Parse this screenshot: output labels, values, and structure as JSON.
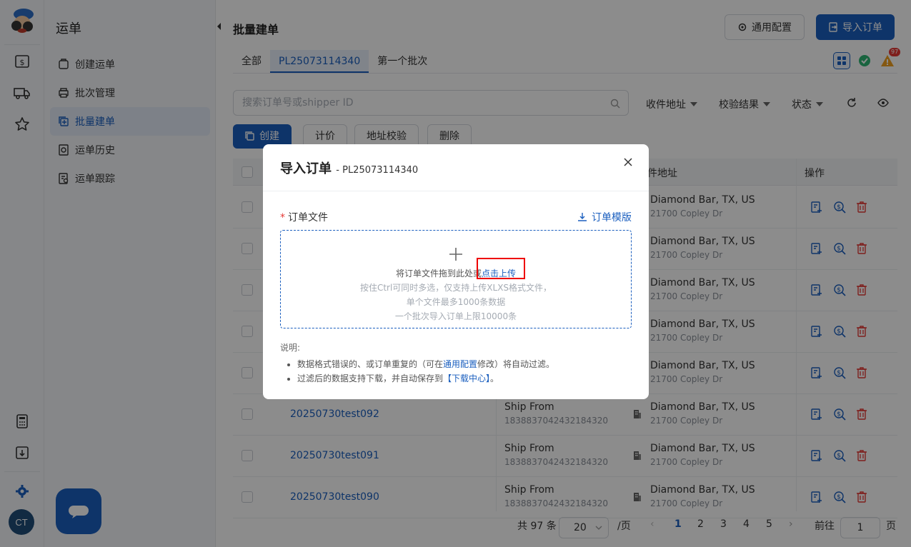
{
  "app": {
    "module_title": "运单",
    "avatar": "CT"
  },
  "sidebar": {
    "items": [
      {
        "label": "创建运单"
      },
      {
        "label": "批次管理"
      },
      {
        "label": "批量建单"
      },
      {
        "label": "运单历史"
      },
      {
        "label": "运单跟踪"
      }
    ]
  },
  "header": {
    "title": "批量建单",
    "config_label": "通用配置",
    "import_label": "导入订单"
  },
  "tabs": [
    {
      "label": "全部"
    },
    {
      "label": "PL25073114340"
    },
    {
      "label": "第一个批次"
    }
  ],
  "status": {
    "warning_count": "97"
  },
  "search": {
    "placeholder": "搜索订单号或shipper ID"
  },
  "filters": {
    "address": "收件地址",
    "validation": "校验结果",
    "status": "状态"
  },
  "toolbar": {
    "create": "创建",
    "price": "计价",
    "verify": "地址校验",
    "delete": "删除"
  },
  "table": {
    "headers": {
      "address": "件地址",
      "actions": "操作"
    },
    "rows": [
      {
        "order_id": "",
        "ship_from": "",
        "ship_from_id": "",
        "address": "Diamond Bar, TX, US",
        "street": "21700 Copley Dr"
      },
      {
        "order_id": "",
        "ship_from": "",
        "ship_from_id": "",
        "address": "Diamond Bar, TX, US",
        "street": "21700 Copley Dr"
      },
      {
        "order_id": "",
        "ship_from": "",
        "ship_from_id": "",
        "address": "Diamond Bar, TX, US",
        "street": "21700 Copley Dr"
      },
      {
        "order_id": "",
        "ship_from": "",
        "ship_from_id": "",
        "address": "Diamond Bar, TX, US",
        "street": "21700 Copley Dr"
      },
      {
        "order_id": "",
        "ship_from": "",
        "ship_from_id": "",
        "address": "Diamond Bar, TX, US",
        "street": "21700 Copley Dr"
      },
      {
        "order_id": "20250730test092",
        "ship_from": "Ship From",
        "ship_from_id": "1838837042432184320",
        "address": "Diamond Bar, TX, US",
        "street": "21700 Copley Dr"
      },
      {
        "order_id": "20250730test091",
        "ship_from": "Ship From",
        "ship_from_id": "1838837042432184320",
        "address": "Diamond Bar, TX, US",
        "street": "21700 Copley Dr"
      },
      {
        "order_id": "20250730test090",
        "ship_from": "Ship From",
        "ship_from_id": "1838837042432184320",
        "address": "Diamond Bar, TX, US",
        "street": "21700 Copley Dr"
      }
    ]
  },
  "pagination": {
    "total": "共 97 条",
    "page_size": "20",
    "per_page": "/页",
    "pages": [
      "1",
      "2",
      "3",
      "4",
      "5"
    ],
    "goto_label": "前往",
    "goto_value": "1",
    "page_suffix": "页"
  },
  "modal": {
    "title": "导入订单",
    "subtitle": "- PL25073114340",
    "field_label": "订单文件",
    "required_mark": "*",
    "template_link": "订单模版",
    "drop_text": "将订单文件拖到此处或",
    "upload_link": "点击上传",
    "hint_1": "按住Ctrl可同时多选，仅支持上传XLXS格式文件，",
    "hint_2": "单个文件最多1000条数据",
    "hint_3": "一个批次导入订单上限10000条",
    "notes_title": "说明:",
    "note_1_a": "数据格式错误的、或订单重复的（可在",
    "note_1_link": "通用配置",
    "note_1_b": "修改）将自动过滤。",
    "note_2_a": "过滤后的数据支持下载，并自动保存到",
    "note_2_link": "【下载中心】",
    "note_2_b": "。"
  },
  "colors": {
    "primary": "#1b5fbf",
    "danger": "#e53935",
    "success": "#2fb673",
    "warning": "#f0a020"
  }
}
